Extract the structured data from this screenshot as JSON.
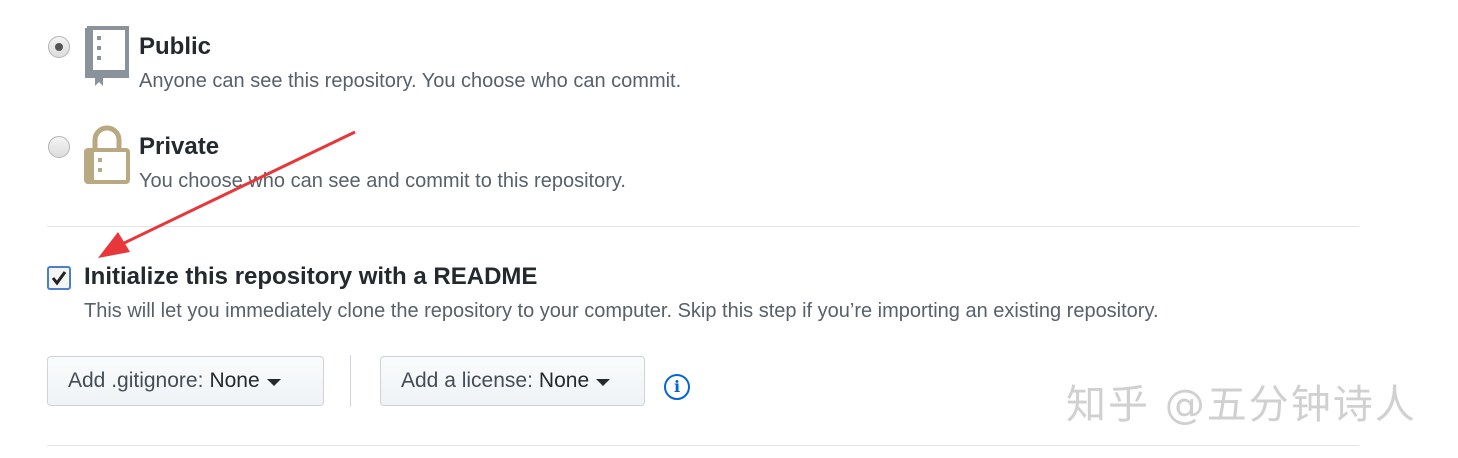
{
  "visibility": {
    "public": {
      "title": "Public",
      "description": "Anyone can see this repository. You choose who can commit.",
      "selected": true,
      "icon": "repo-book-icon"
    },
    "private": {
      "title": "Private",
      "description": "You choose who can see and commit to this repository.",
      "selected": false,
      "icon": "lock-icon"
    }
  },
  "readme": {
    "label": "Initialize this repository with a README",
    "description": "This will let you immediately clone the repository to your computer. Skip this step if you’re importing an existing repository.",
    "checked": true
  },
  "gitignore": {
    "label": "Add .gitignore:",
    "value": "None"
  },
  "license": {
    "label": "Add a license:",
    "value": "None"
  },
  "info_icon": "info-icon",
  "watermark": "知乎 @五分钟诗人",
  "colors": {
    "annotation_arrow": "#e8373a",
    "accent": "#0366d6",
    "lock": "#b9a983",
    "book": "#8a939b"
  }
}
